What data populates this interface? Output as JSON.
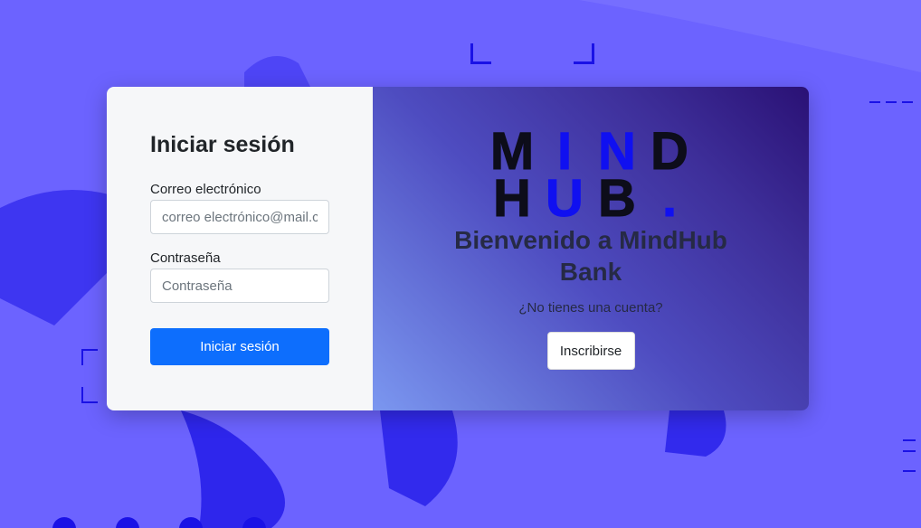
{
  "colors": {
    "background": "#6c63ff",
    "accent_dark_blue": "#1a12e6",
    "primary_button": "#0d6efd",
    "logo_blue": "#1010f0",
    "logo_dark": "#0d0d1a"
  },
  "login": {
    "title": "Iniciar sesión",
    "email_label": "Correo electrónico",
    "email_placeholder": "correo electrónico@mail.com",
    "password_label": "Contraseña",
    "password_placeholder": "Contraseña",
    "submit_label": "Iniciar sesión"
  },
  "brand": {
    "logo_row1": [
      "M",
      "I",
      "N",
      "D"
    ],
    "logo_row2": [
      "H",
      "U",
      "B",
      "."
    ],
    "welcome": "Bienvenido a MindHub Bank",
    "no_account": "¿No tienes una cuenta?",
    "signup_label": "Inscribirse"
  }
}
